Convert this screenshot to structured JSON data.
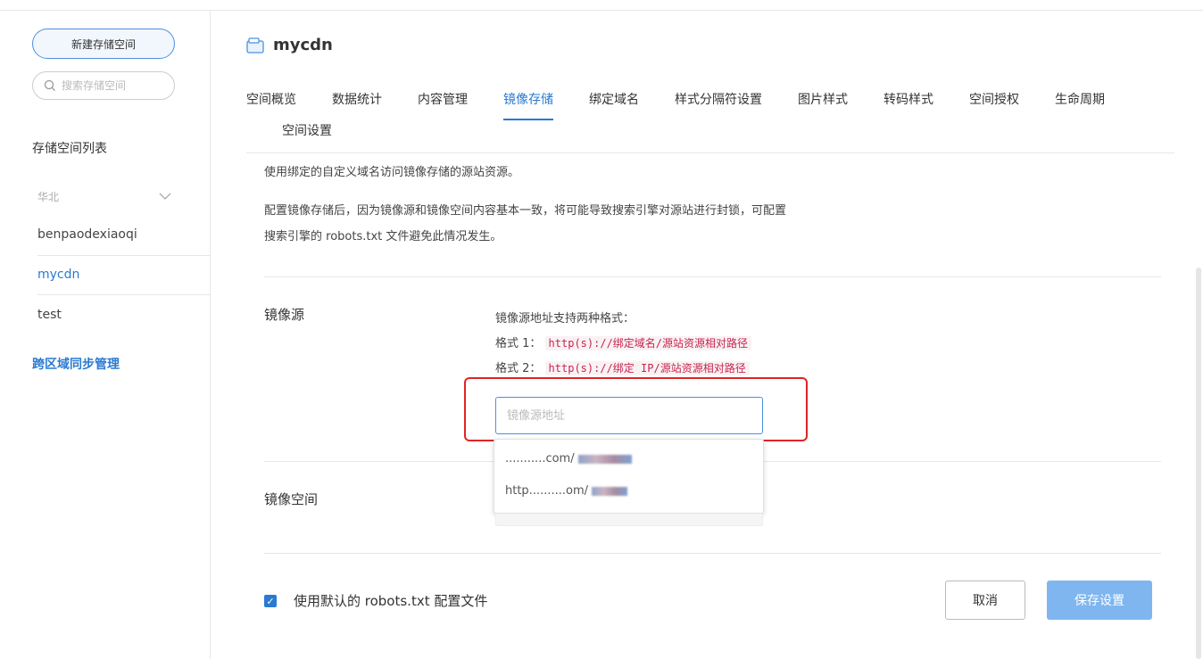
{
  "sidebar": {
    "new_button": "新建存储空间",
    "search_placeholder": "搜索存储空间",
    "list_title": "存储空间列表",
    "region": "华北",
    "buckets": [
      "benpaodexiaoqi",
      "mycdn",
      "test"
    ],
    "cross_region": "跨区域同步管理"
  },
  "header": {
    "bucket_name": "mycdn",
    "tabs": [
      "空间概览",
      "数据统计",
      "内容管理",
      "镜像存储",
      "绑定域名",
      "样式分隔符设置",
      "图片样式",
      "转码样式",
      "空间授权",
      "生命周期",
      "空间设置"
    ],
    "active_tab": "镜像存储"
  },
  "intro": {
    "line1": "使用绑定的自定义域名访问镜像存储的源站资源。",
    "line2": "配置镜像存储后，因为镜像源和镜像空间内容基本一致，将可能导致搜索引擎对源站进行封锁，可配置",
    "line3": "搜索引擎的 robots.txt 文件避免此情况发生。"
  },
  "mirror_source": {
    "label": "镜像源",
    "hint": "镜像源地址支持两种格式：",
    "format1_label": "格式 1：",
    "format1_code": "http(s)://绑定域名/源站资源相对路径",
    "format2_label": "格式 2：",
    "format2_code": "http(s)://绑定 IP/源站资源相对路径",
    "input_placeholder": "镜像源地址",
    "suggestions": [
      "...........com/",
      "http..........om/"
    ]
  },
  "mirror_space": {
    "label": "镜像空间"
  },
  "footer": {
    "checkbox_label": "使用默认的 robots.txt 配置文件",
    "checkbox_checked": true,
    "cancel": "取消",
    "save": "保存设置"
  },
  "colors": {
    "accent": "#2a7ad1",
    "highlight_box": "#e02424",
    "save_disabled": "#7fb6f0"
  }
}
